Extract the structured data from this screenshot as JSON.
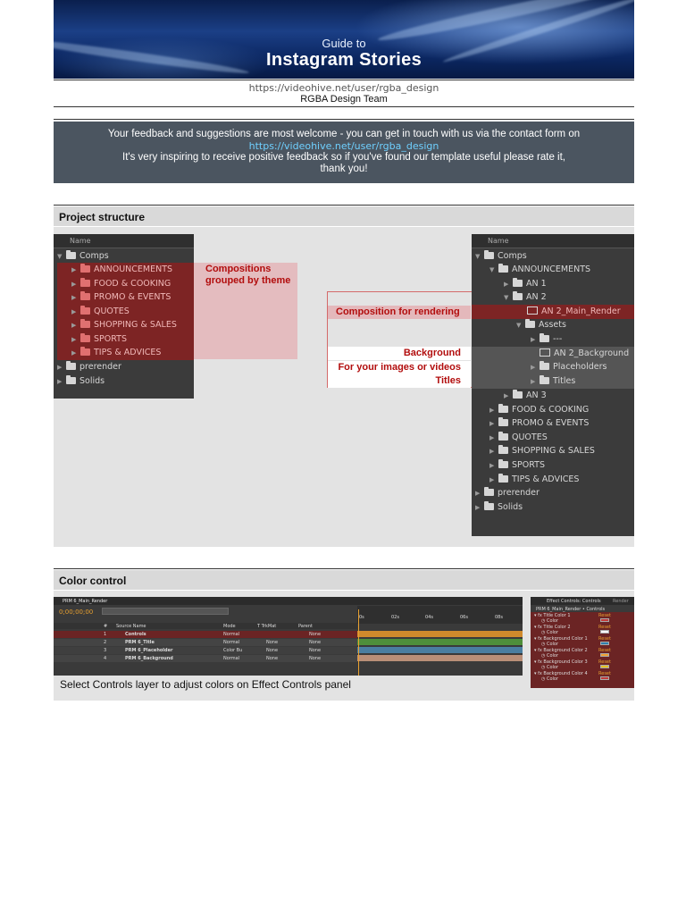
{
  "banner": {
    "subtitle": "Guide to",
    "title": "Instagram Stories"
  },
  "header": {
    "link": "https://videohive.net/user/rgba_design",
    "team": "RGBA Design Team"
  },
  "feedback": {
    "line1": "Your feedback and suggestions are most welcome - you can get in touch with us via the contact form on",
    "link": "https://videohive.net/user/rgba_design",
    "line2": "It's very inspiring to receive positive feedback so if you've found our template useful please rate it,",
    "line3": "thank you!"
  },
  "project": {
    "heading": "Project structure",
    "left_panel": {
      "column": "Name",
      "items": [
        "Comps",
        "ANNOUNCEMENTS",
        "FOOD & COOKING",
        "PROMO & EVENTS",
        "QUOTES",
        "SHOPPING & SALES",
        "SPORTS",
        "TIPS & ADVICES",
        "prerender",
        "Solids"
      ]
    },
    "callout_compositions": "Compositions grouped by theme",
    "callouts": {
      "rendering": "Composition for rendering",
      "background": "Background",
      "images": "For your images or videos",
      "titles": "Titles"
    },
    "right_panel": {
      "column": "Name",
      "items": [
        "Comps",
        "ANNOUNCEMENTS",
        "AN 1",
        "AN 2",
        "AN 2_Main_Render",
        "Assets",
        "---",
        "AN 2_Background",
        "Placeholders",
        "Titles",
        "AN 3",
        "FOOD & COOKING",
        "PROMO & EVENTS",
        "QUOTES",
        "SHOPPING & SALES",
        "SPORTS",
        "TIPS & ADVICES",
        "prerender",
        "Solids"
      ]
    }
  },
  "color_control": {
    "heading": "Color control",
    "caption": "Select Controls layer to adjust colors on Effect Controls panel",
    "timeline": {
      "tab": "PRM 6_Main_Render",
      "timecode": "0;00;00;00",
      "columns": [
        "#",
        "Source Name",
        "Mode",
        "T TrkMat",
        "Parent"
      ],
      "layers": [
        {
          "num": "1",
          "name": "Controls",
          "mode": "Normal",
          "trkmat": "",
          "parent": "None"
        },
        {
          "num": "2",
          "name": "PRM 6_Title",
          "mode": "Normal",
          "trkmat": "None",
          "parent": "None"
        },
        {
          "num": "3",
          "name": "PRM 6_Placeholder",
          "mode": "Color Bu",
          "trkmat": "None",
          "parent": "None"
        },
        {
          "num": "4",
          "name": "PRM 6_Background",
          "mode": "Normal",
          "trkmat": "None",
          "parent": "None"
        }
      ],
      "ticks": [
        "0s",
        "02s",
        "04s",
        "06s",
        "08s"
      ]
    },
    "effect_panel": {
      "tab": "Effect Controls: Controls",
      "tab2": "Render",
      "path": "PRM 6_Main_Render • Controls",
      "effects": [
        "Title Color 1",
        "Title Color 2",
        "Background Color 1",
        "Background Color 2",
        "Background Color 3",
        "Background Color 4"
      ],
      "reset": "Reset",
      "color_label": "Color",
      "swatches": [
        "#c43a3a",
        "#ffffff",
        "#2f7fae",
        "#f0a030",
        "#e8c020",
        "#c43a3a"
      ]
    }
  }
}
